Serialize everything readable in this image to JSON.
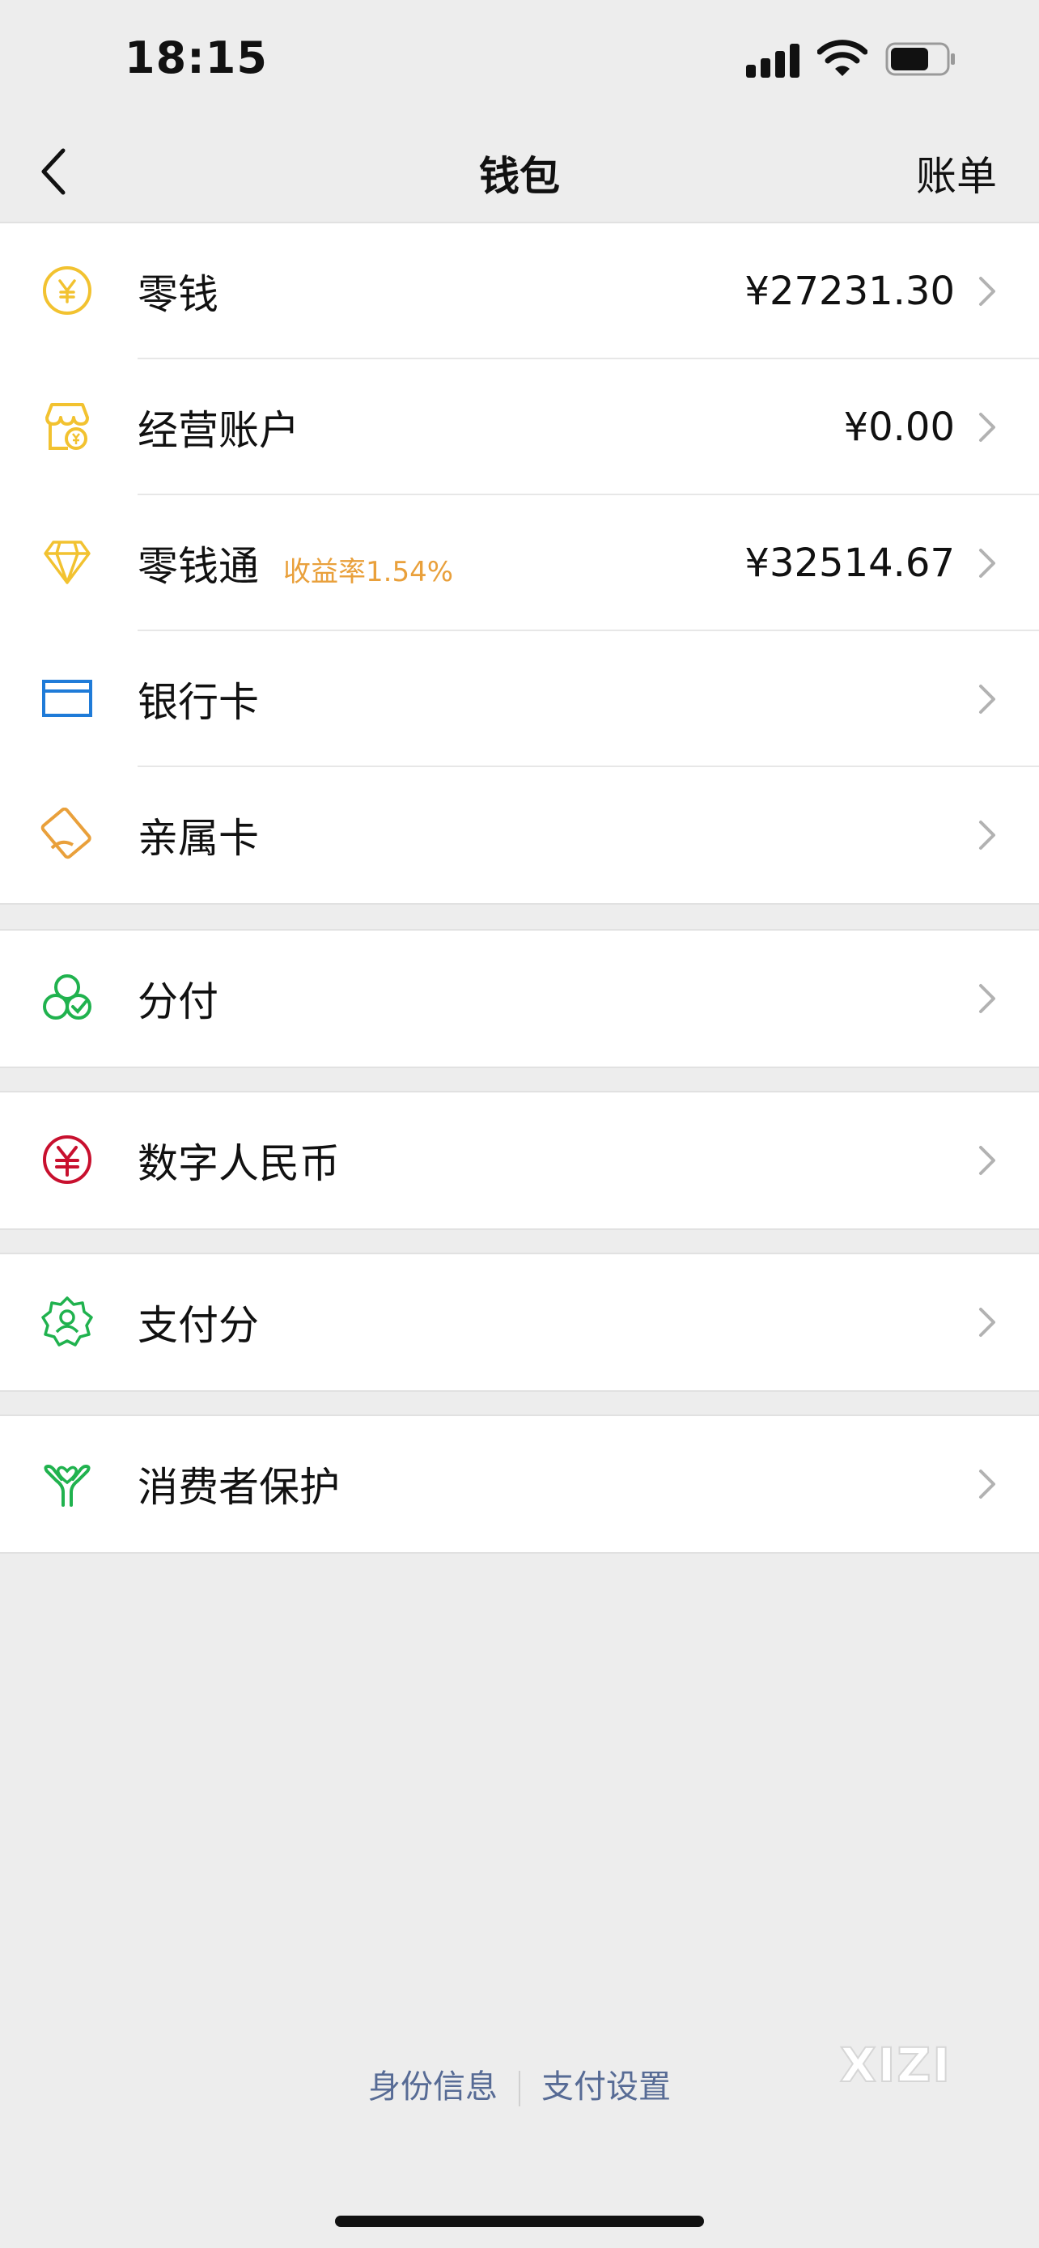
{
  "status_bar": {
    "time": "18:15",
    "icons": [
      "signal-icon",
      "wifi-icon",
      "battery-icon"
    ]
  },
  "nav": {
    "back_icon": "chevron-left-icon",
    "title": "钱包",
    "right": "账单"
  },
  "groups": [
    {
      "rows": [
        {
          "label": "零钱",
          "value": "¥27231.30",
          "icon": "yen-coin-icon",
          "icon_color": "#f2c230"
        },
        {
          "label": "经营账户",
          "value": "¥0.00",
          "icon": "shop-account-icon",
          "icon_color": "#f2c230"
        },
        {
          "label": "零钱通",
          "badge": "收益率1.54%",
          "badge_color": "#e9a03b",
          "value": "¥32514.67",
          "icon": "diamond-icon",
          "icon_color": "#f2c230"
        },
        {
          "label": "银行卡",
          "icon": "bank-card-icon",
          "icon_color": "#1f7bd8"
        },
        {
          "label": "亲属卡",
          "icon": "family-card-icon",
          "icon_color": "#e9a03b"
        }
      ]
    },
    {
      "rows": [
        {
          "label": "分付",
          "icon": "fenfu-icon",
          "icon_color": "#20b24e"
        }
      ]
    },
    {
      "rows": [
        {
          "label": "数字人民币",
          "icon": "digital-rmb-icon",
          "icon_color": "#c8102e"
        }
      ]
    },
    {
      "rows": [
        {
          "label": "支付分",
          "icon": "payscore-icon",
          "icon_color": "#20b24e"
        }
      ]
    },
    {
      "rows": [
        {
          "label": "消费者保护",
          "icon": "consumer-protection-icon",
          "icon_color": "#20b24e"
        }
      ]
    }
  ],
  "footer": {
    "identity": "身份信息",
    "settings": "支付设置"
  },
  "watermark": "XIZI"
}
